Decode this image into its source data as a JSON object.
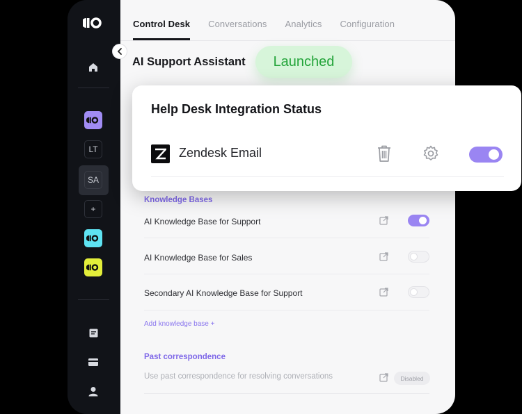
{
  "sidebar": {
    "brand_icon": "brand-logo-icon",
    "items": [
      {
        "type": "icon",
        "icon": "home-icon"
      },
      {
        "type": "workspace",
        "icon": "workspace-logo-icon",
        "color": "#a18cf4"
      },
      {
        "type": "initials",
        "label": "LT"
      },
      {
        "type": "initials",
        "label": "SA",
        "active": true
      },
      {
        "type": "add",
        "label": "+"
      },
      {
        "type": "workspace",
        "icon": "workspace-logo-icon",
        "color": "#5ee3f2"
      },
      {
        "type": "workspace",
        "icon": "workspace-logo-icon",
        "color": "#e3ee3a"
      },
      {
        "type": "icon",
        "icon": "document-icon"
      },
      {
        "type": "icon",
        "icon": "credit-card-icon"
      },
      {
        "type": "icon",
        "icon": "user-icon"
      }
    ]
  },
  "tabs": [
    {
      "label": "Control Desk",
      "active": true
    },
    {
      "label": "Conversations"
    },
    {
      "label": "Analytics"
    },
    {
      "label": "Configuration"
    }
  ],
  "assistant": {
    "title": "AI Support Assistant",
    "status": "Launched",
    "status_color": "#23a43a"
  },
  "integration_card": {
    "title": "Help Desk Integration Status",
    "integration": {
      "name": "Zendesk Email",
      "icon": "zendesk-logo-icon",
      "enabled": true
    }
  },
  "knowledge_bases": {
    "heading": "Knowledge Bases",
    "items": [
      {
        "label": "AI Knowledge Base for Support",
        "enabled": true
      },
      {
        "label": "AI Knowledge Base for Sales",
        "enabled": false
      },
      {
        "label": "Secondary AI Knowledge Base for Support",
        "enabled": false
      }
    ],
    "add_label": "Add knowledge base  +"
  },
  "past_correspondence": {
    "heading": "Past correspondence",
    "description": "Use past correspondence for resolving conversations",
    "status": "Disabled"
  },
  "colors": {
    "accent": "#9a85f2",
    "accent_text": "#7f68e8",
    "success_bg": "#d7f5da"
  }
}
